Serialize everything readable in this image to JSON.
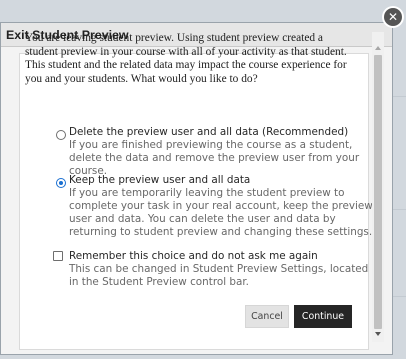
{
  "dialog": {
    "title": "Exit Student Preview",
    "close_symbol": "✕",
    "intro": "You are leaving student preview. Using student preview created a student preview in your course with all of your activity as that student. This student and the related data may impact the course experience for you and your students. What would you like to do?",
    "options": [
      {
        "label": "Delete the preview user and all data (Recommended)",
        "description": "If you are finished previewing the course as a student, delete the data and remove the preview user from your course.",
        "selected": false
      },
      {
        "label": "Keep the preview user and all data",
        "description": "If you are temporarily leaving the student preview to complete your task in your real account, keep the preview user and data. You can delete the user and data by returning to student preview and changing these settings.",
        "selected": true
      }
    ],
    "remember": {
      "label": "Remember this choice and do not ask me again",
      "description": "This can be changed in Student Preview Settings, located in the Student Preview control bar.",
      "checked": false
    },
    "buttons": {
      "cancel": "Cancel",
      "continue": "Continue"
    }
  }
}
